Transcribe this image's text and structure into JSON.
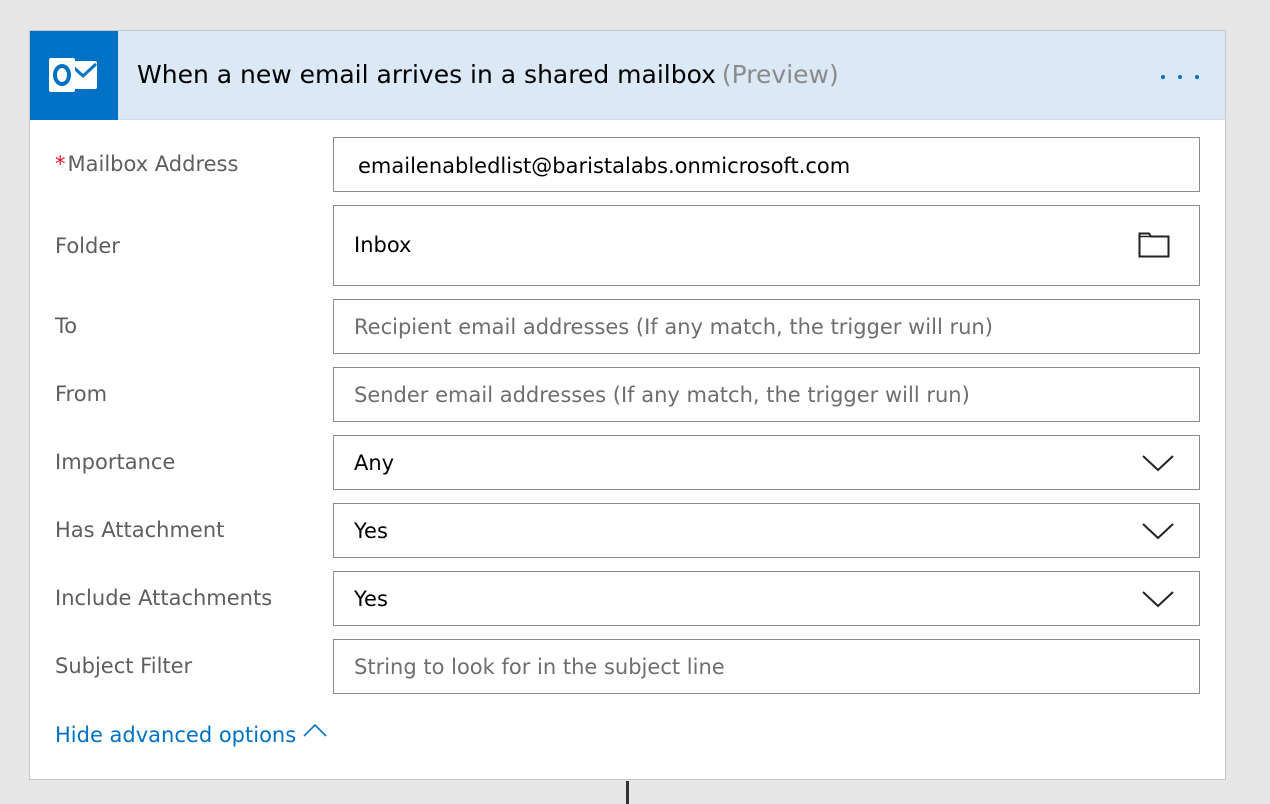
{
  "header": {
    "title": "When a new email arrives in a shared mailbox",
    "tag": "(Preview)",
    "logo_icon": "outlook-icon",
    "menu_icon": "more-dots-icon"
  },
  "fields": {
    "mailbox": {
      "required_mark": "*",
      "label": "Mailbox Address",
      "value": "emailenabledlist@baristalabs.onmicrosoft.com"
    },
    "folder": {
      "label": "Folder",
      "value": "Inbox",
      "icon": "folder-icon"
    },
    "to": {
      "label": "To",
      "placeholder": "Recipient email addresses (If any match, the trigger will run)"
    },
    "from": {
      "label": "From",
      "placeholder": "Sender email addresses (If any match, the trigger will run)"
    },
    "importance": {
      "label": "Importance",
      "value": "Any"
    },
    "has_attachment": {
      "label": "Has Attachment",
      "value": "Yes"
    },
    "include_attachments": {
      "label": "Include Attachments",
      "value": "Yes"
    },
    "subject_filter": {
      "label": "Subject Filter",
      "placeholder": "String to look for in the subject line"
    }
  },
  "advanced": {
    "label": "Hide advanced options",
    "icon": "chevron-up-icon"
  },
  "colors": {
    "accent": "#0072c6",
    "header_bg": "#dbe8f6",
    "required": "#e81123"
  }
}
